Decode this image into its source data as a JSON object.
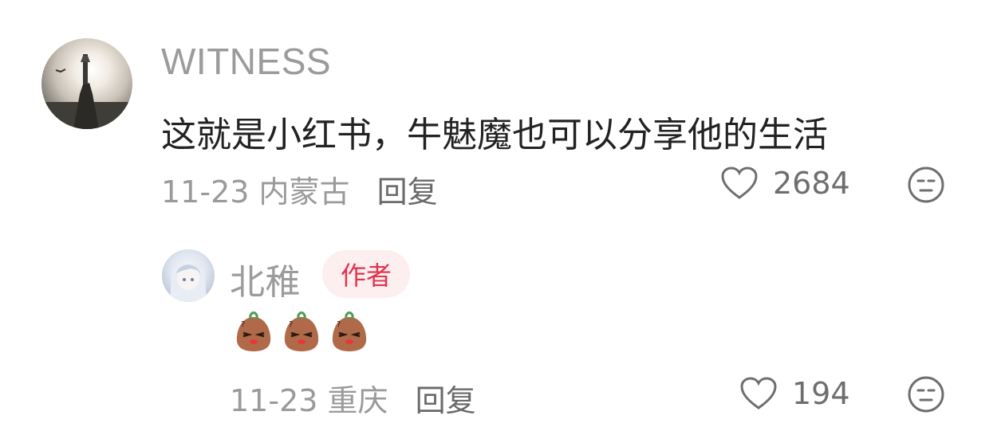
{
  "comment": {
    "username": "WITNESS",
    "text": "这就是小红书，牛魅魔也可以分享他的生活",
    "date": "11-23",
    "location": "内蒙古",
    "reply_label": "回复",
    "likes": "2684"
  },
  "reply": {
    "username": "北稚",
    "author_badge": "作者",
    "emoji_count": 3,
    "date": "11-23",
    "location": "重庆",
    "reply_label": "回复",
    "likes": "194"
  },
  "colors": {
    "username": "#9b9b9b",
    "body_text": "#222222",
    "meta_text": "#9a9a9a",
    "badge_bg": "#fdeef0",
    "badge_text": "#e0344b"
  },
  "icons": [
    "heart-outline-icon",
    "neutral-face-icon",
    "sweet-potato-emoji"
  ]
}
